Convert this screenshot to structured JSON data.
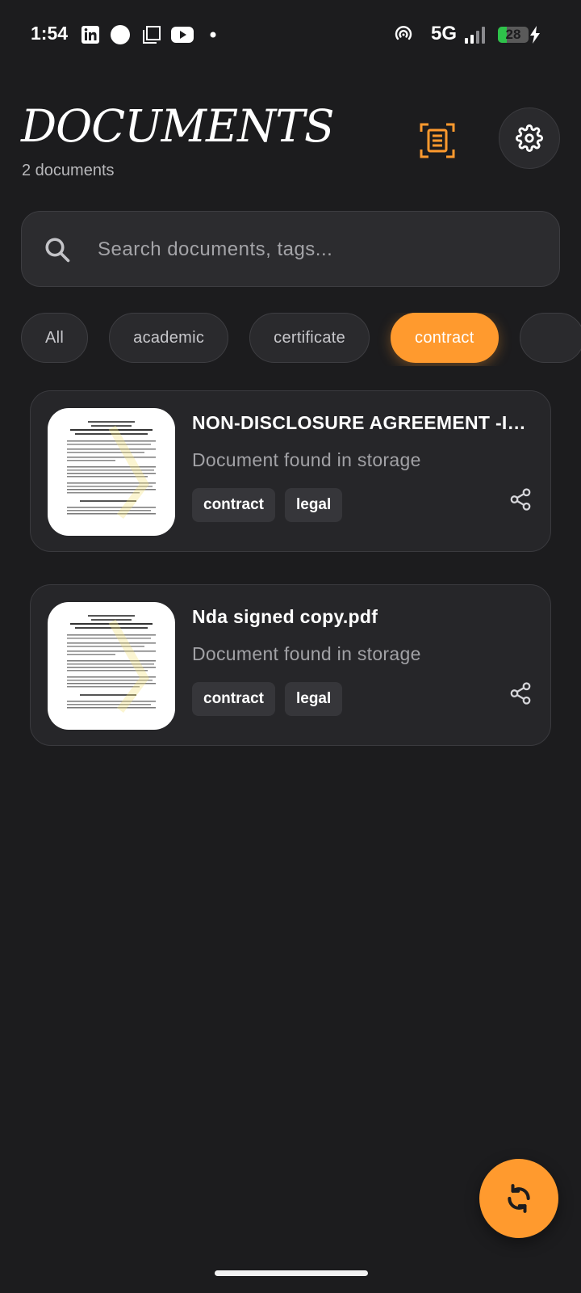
{
  "status_bar": {
    "time": "1:54",
    "network": "5G",
    "battery_level": "28",
    "battery_fraction": 0.28,
    "icons": [
      "linkedin-icon",
      "circle-icon",
      "gallery-icon",
      "youtube-icon",
      "dot-icon",
      "hotspot-icon",
      "signal-icon",
      "battery-icon",
      "charging-icon"
    ]
  },
  "header": {
    "title": "DOCUMENTS",
    "count_label": "2 documents",
    "scan_icon": "document-scan-icon",
    "settings_icon": "gear-icon"
  },
  "search": {
    "placeholder": "Search documents, tags...",
    "value": "",
    "icon": "search-icon"
  },
  "filters": {
    "chips": [
      "All",
      "academic",
      "certificate",
      "contract",
      ""
    ],
    "selected": "contract"
  },
  "documents": [
    {
      "title": "NON-DISCLOSURE AGREEMENT -IN...",
      "subtitle": "Document found in storage",
      "tags": [
        "contract",
        "legal"
      ],
      "share_icon": "share-icon"
    },
    {
      "title": "Nda signed copy.pdf",
      "subtitle": "Document found in storage",
      "tags": [
        "contract",
        "legal"
      ],
      "share_icon": "share-icon"
    }
  ],
  "fab": {
    "icon": "sync-icon"
  },
  "colors": {
    "background": "#1c1c1e",
    "accent": "#ff9a2e",
    "card": "#262629",
    "chip": "#2a2a2d",
    "muted_text": "#a2a2a6"
  }
}
